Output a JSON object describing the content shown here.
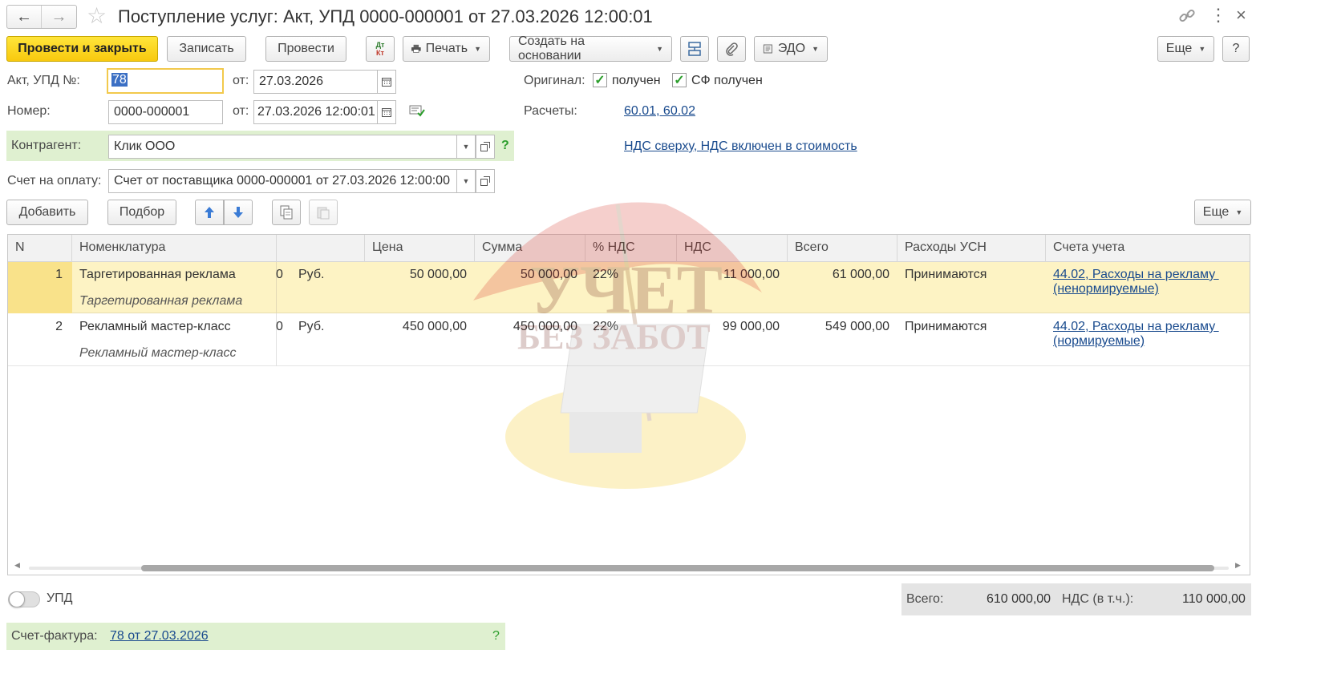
{
  "header": {
    "title": "Поступление услуг: Акт, УПД 0000-000001 от 27.03.2026 12:00:01"
  },
  "toolbar": {
    "post_close": "Провести и закрыть",
    "save": "Записать",
    "post": "Провести",
    "dtkt_top": "Дт",
    "dtkt_bottom": "Кт",
    "print": "Печать",
    "create_based": "Создать на основании",
    "edo": "ЭДО",
    "more": "Еще",
    "help": "?"
  },
  "form": {
    "act_label": "Акт, УПД №:",
    "act_value": "78",
    "from_label": "от:",
    "act_date": "27.03.2026",
    "number_label": "Номер:",
    "number_value": "0000-000001",
    "number_datetime": "27.03.2026 12:00:01",
    "original_label": "Оригинал:",
    "received_label": "получен",
    "sf_received_label": "СФ получен",
    "settlements_label": "Расчеты:",
    "settlements_link": "60.01, 60.02",
    "vat_link": "НДС сверху, НДС включен в стоимость",
    "counterparty_label": "Контрагент:",
    "counterparty_value": "Клик ООО",
    "counterparty_help": "?",
    "invoice_label": "Счет на оплату:",
    "invoice_value": "Счет от поставщика 0000-000001 от 27.03.2026 12:00:00"
  },
  "table_toolbar": {
    "add": "Добавить",
    "pick": "Подбор",
    "more": "Еще"
  },
  "table": {
    "columns": [
      "N",
      "Номенклатура",
      "",
      "Цена",
      "Сумма",
      "% НДС",
      "НДС",
      "Всего",
      "Расходы УСН",
      "Счета учета"
    ],
    "rows": [
      {
        "n": "1",
        "item": "Таргетированная реклама",
        "item_sub": "Таргетированная реклама",
        "qty": "0",
        "unit": "Руб.",
        "price": "50 000,00",
        "sum": "50 000,00",
        "vat_rate": "22%",
        "vat": "11 000,00",
        "total": "61 000,00",
        "usn": "Принимаются",
        "account_1": "44.02, Расходы на рекламу ",
        "account_2": "(ненормируемые)"
      },
      {
        "n": "2",
        "item": "Рекламный мастер-класс",
        "item_sub": "Рекламный мастер-класс",
        "qty": "0",
        "unit": "Руб.",
        "price": "450 000,00",
        "sum": "450 000,00",
        "vat_rate": "22%",
        "vat": "99 000,00",
        "total": "549 000,00",
        "usn": "Принимаются",
        "account_1": "44.02, Расходы на рекламу ",
        "account_2": "(нормируемые)"
      }
    ]
  },
  "footer": {
    "upd_label": "УПД",
    "total_label": "Всего:",
    "total_value": "610 000,00",
    "vat_label": "НДС (в т.ч.):",
    "vat_value": "110 000,00",
    "invoice_label": "Счет-фактура:",
    "invoice_link": "78 от 27.03.2026",
    "invoice_help": "?"
  },
  "watermark": {
    "line1": "УЧЕТ",
    "line2": "БЕЗ ЗАБОТ"
  },
  "colors": {
    "selected_row": "#fdf3c4",
    "primary_button": "#f8d21c",
    "green_band": "#dff0d0",
    "link": "#1a4b8e"
  }
}
